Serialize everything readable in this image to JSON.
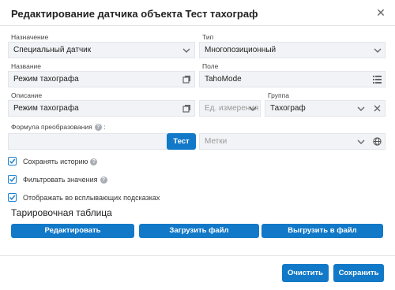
{
  "dialog": {
    "title": "Редактирование датчика объекта Тест тахограф"
  },
  "fields": {
    "purpose": {
      "label": "Назначение",
      "value": "Специальный датчик"
    },
    "type": {
      "label": "Тип",
      "value": "Многопозиционный"
    },
    "name": {
      "label": "Название",
      "value": "Режим тахографа"
    },
    "field": {
      "label": "Поле",
      "value": "TahoMode"
    },
    "description": {
      "label": "Описание",
      "value": "Режим тахографа"
    },
    "unit": {
      "placeholder": "Ед. измерения"
    },
    "group": {
      "label": "Группа",
      "value": "Тахограф"
    },
    "formula": {
      "label": "Формула преобразования",
      "value": ""
    },
    "tags": {
      "placeholder": "Метки"
    }
  },
  "buttons": {
    "test": "Тест",
    "edit": "Редактировать",
    "upload": "Загрузить файл",
    "download": "Выгрузить в файл",
    "clear": "Очистить",
    "save": "Сохранить"
  },
  "checkboxes": [
    {
      "label": "Сохранять историю",
      "checked": true,
      "help": true
    },
    {
      "label": "Фильтровать значения",
      "checked": true,
      "help": true
    },
    {
      "label": "Отображать во всплывающих подсказках",
      "checked": true,
      "help": false
    }
  ],
  "calibration": {
    "title": "Тарировочная таблица"
  },
  "icons": {
    "close": "close-icon",
    "copy": "copy-icon",
    "list": "list-icon",
    "chevron": "chevron-down-icon",
    "globe": "globe-icon",
    "help": "help-icon",
    "check": "check-icon"
  },
  "colors": {
    "accent": "#1279c8",
    "field_bg": "#f1f3f6",
    "checkbox_border": "#1a7fce"
  }
}
